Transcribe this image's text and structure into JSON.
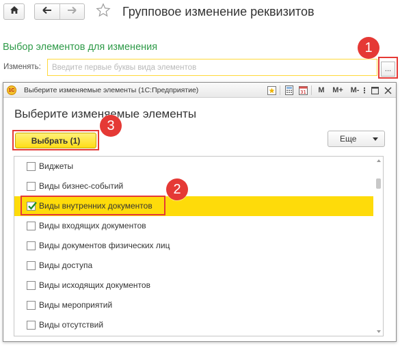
{
  "window": {
    "title": "Групповое изменение реквизитов",
    "home_icon": "home-icon",
    "back_icon": "arrow-left-icon",
    "forward_icon": "arrow-right-icon",
    "favorite_icon": "star-icon"
  },
  "selection_section": {
    "title": "Выбор элементов для изменения",
    "change_label": "Изменять:",
    "input_placeholder": "Введите первые буквы вида элементов",
    "input_value": "",
    "picker_button_label": "..."
  },
  "dialog": {
    "titlebar_text": "Выберите изменяемые элементы  (1С:Предприятие)",
    "app_logo_text": "1С",
    "titlebar_icons": {
      "favorite": "favorites-icon",
      "calculator": "calculator-icon",
      "calendar": "calendar-icon",
      "calendar_text": "31",
      "memory_m": "M",
      "memory_mplus": "M+",
      "memory_mminus": "M-",
      "more": "⋮",
      "maximize": "maximize-icon",
      "close": "close-icon"
    },
    "heading": "Выберите изменяемые элементы",
    "select_button_label": "Выбрать (1)",
    "more_button_label": "Еще",
    "items": [
      {
        "label": "Виджеты",
        "checked": false
      },
      {
        "label": "Виды бизнес-событий",
        "checked": false
      },
      {
        "label": "Виды внутренних документов",
        "checked": true
      },
      {
        "label": "Виды входящих документов",
        "checked": false
      },
      {
        "label": "Виды документов физических лиц",
        "checked": false
      },
      {
        "label": "Виды доступа",
        "checked": false
      },
      {
        "label": "Виды исходящих документов",
        "checked": false
      },
      {
        "label": "Виды мероприятий",
        "checked": false
      },
      {
        "label": "Виды отсутствий",
        "checked": false
      }
    ]
  },
  "annotations": {
    "badge_1": "1",
    "badge_2": "2",
    "badge_3": "3",
    "highlight_color": "#e53935"
  },
  "colors": {
    "section_title": "#2e9a48",
    "selected_row": "#fedb0a",
    "primary_button": "#ffdd16",
    "input_border": "#ffd83a"
  }
}
